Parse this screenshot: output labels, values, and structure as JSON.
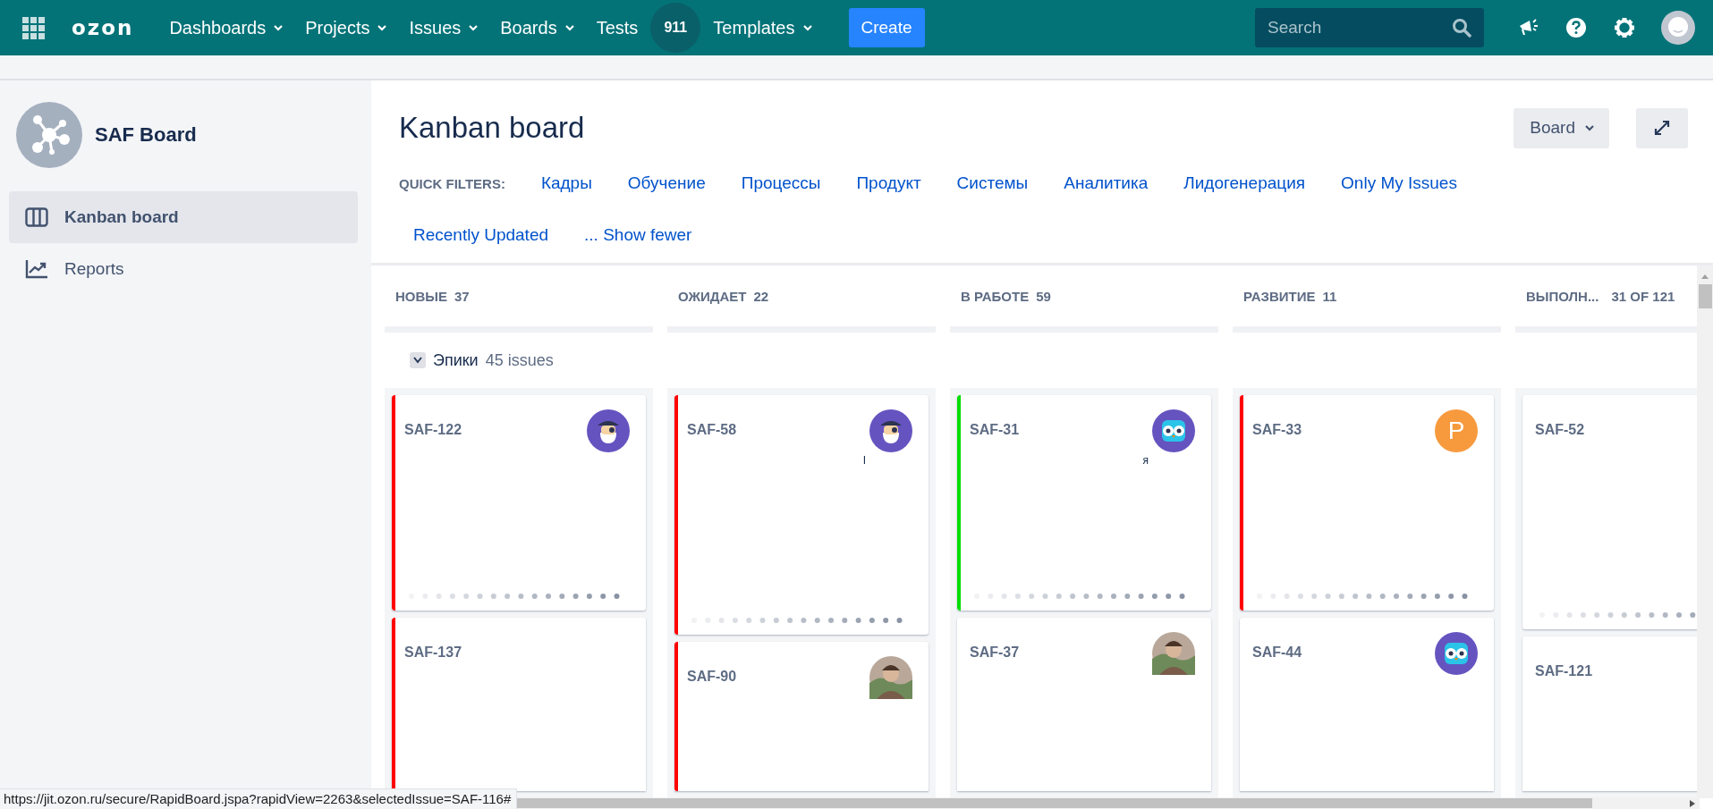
{
  "nav": {
    "items": [
      {
        "label": "Dashboards",
        "kind": "menu"
      },
      {
        "label": "Projects",
        "kind": "menu"
      },
      {
        "label": "Issues",
        "kind": "menu"
      },
      {
        "label": "Boards",
        "kind": "menu"
      },
      {
        "label": "Tests",
        "kind": "link"
      },
      {
        "label": "911",
        "kind": "badge"
      },
      {
        "label": "Templates",
        "kind": "menu"
      }
    ],
    "logo": "ozon",
    "create": "Create",
    "search": {
      "placeholder": "Search"
    }
  },
  "sidebar": {
    "project": "SAF Board",
    "items": [
      {
        "label": "Kanban board",
        "selected": true
      },
      {
        "label": "Reports",
        "selected": false
      }
    ]
  },
  "page": {
    "title": "Kanban board",
    "view_button": "Board"
  },
  "quick_filters": {
    "label": "QUICK FILTERS:",
    "items": [
      "Кадры",
      "Обучение",
      "Процессы",
      "Продукт",
      "Системы",
      "Аналитика",
      "Лидогенерация",
      "Only My Issues",
      "Recently Updated",
      "... Show fewer"
    ]
  },
  "swimlane": {
    "title": "Эпики",
    "count": "45 issues",
    "expanded": true
  },
  "columns": [
    {
      "name": "НОВЫЕ",
      "count": "37",
      "cards": [
        {
          "key": "SAF-122",
          "color": "#ff0000",
          "avatar": {
            "kind": "pirate"
          },
          "dots": true
        },
        {
          "key": "SAF-137",
          "color": "#ff0000",
          "dots": false
        }
      ]
    },
    {
      "name": "ОЖИДАЕТ",
      "count": "22",
      "cards": [
        {
          "key": "SAF-58",
          "color": "#ff0000",
          "avatar": {
            "kind": "pirate"
          },
          "note": "I",
          "dots": true
        },
        {
          "key": "SAF-90",
          "color": "#ff0000",
          "dots": false
        }
      ]
    },
    {
      "name": "В РАБОТЕ",
      "count": "59",
      "cards": [
        {
          "key": "SAF-31",
          "color": "#00dd00",
          "avatar": {
            "kind": "owl"
          },
          "note": "я",
          "dots": true
        },
        {
          "key": "SAF-37",
          "dots": false
        }
      ]
    },
    {
      "name": "РАЗВИТИЕ",
      "count": "11",
      "cards": [
        {
          "key": "SAF-33",
          "color": "#ff0000",
          "avatar": {
            "kind": "letter",
            "text": "P"
          },
          "dots": true
        },
        {
          "key": "SAF-44",
          "avatar": {
            "kind": "owl"
          },
          "dots": false
        }
      ]
    },
    {
      "name": "ВЫПОЛН...",
      "count": "31 OF 121",
      "cards": [
        {
          "key": "SAF-52",
          "dots": true
        },
        {
          "key": "SAF-121",
          "dots": false
        }
      ]
    }
  ],
  "status_url": "https://jit.ozon.ru/secure/RapidBoard.jspa?rapidView=2263&selectedIssue=SAF-116#"
}
